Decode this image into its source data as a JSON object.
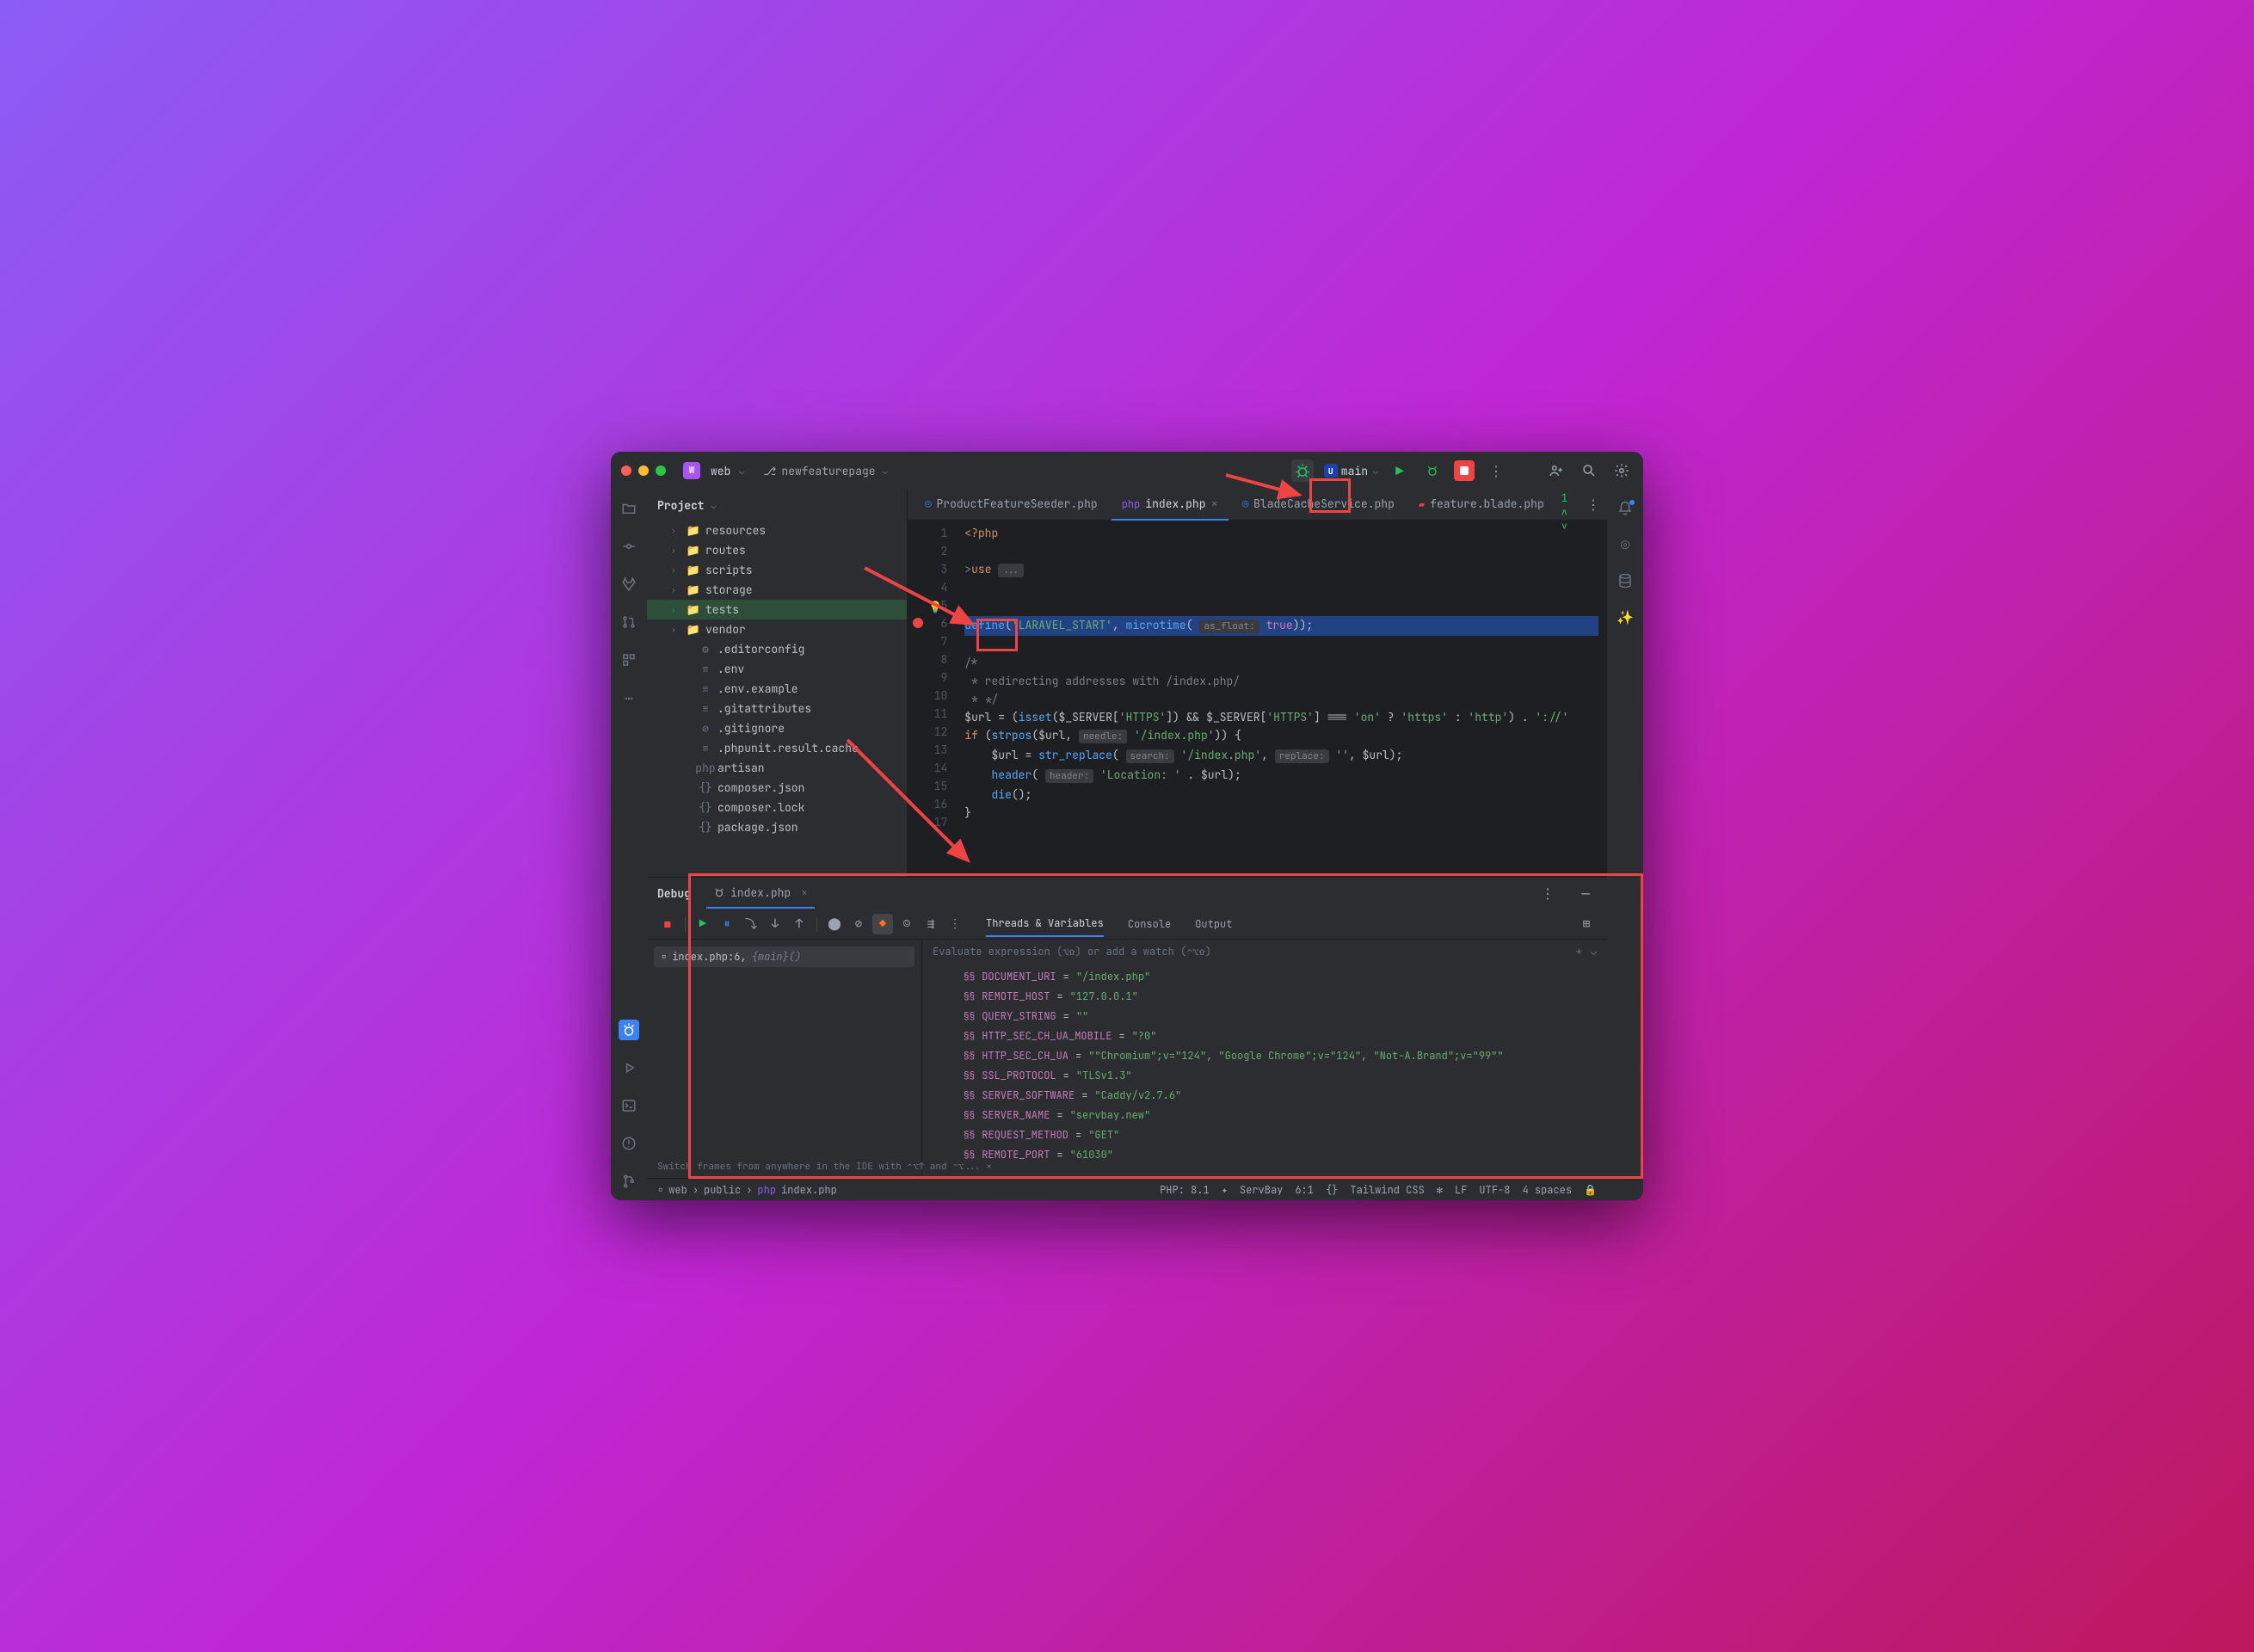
{
  "titlebar": {
    "project": "web",
    "branch": "newfeaturepage",
    "main_label": "main"
  },
  "project_panel": {
    "title": "Project",
    "items": [
      {
        "name": "resources",
        "type": "folder",
        "indent": 28,
        "arrow": true
      },
      {
        "name": "routes",
        "type": "folder",
        "indent": 28,
        "arrow": true
      },
      {
        "name": "scripts",
        "type": "folder",
        "indent": 28,
        "arrow": true
      },
      {
        "name": "storage",
        "type": "folder",
        "indent": 28,
        "arrow": true
      },
      {
        "name": "tests",
        "type": "folder",
        "indent": 28,
        "arrow": true,
        "selected": true
      },
      {
        "name": "vendor",
        "type": "folder-y",
        "indent": 28,
        "arrow": true
      },
      {
        "name": ".editorconfig",
        "type": "gear",
        "indent": 42
      },
      {
        "name": ".env",
        "type": "file",
        "indent": 42
      },
      {
        "name": ".env.example",
        "type": "file",
        "indent": 42
      },
      {
        "name": ".gitattributes",
        "type": "file",
        "indent": 42
      },
      {
        "name": ".gitignore",
        "type": "gitignore",
        "indent": 42
      },
      {
        "name": ".phpunit.result.cache",
        "type": "file",
        "indent": 42
      },
      {
        "name": "artisan",
        "type": "php",
        "indent": 42
      },
      {
        "name": "composer.json",
        "type": "json",
        "indent": 42
      },
      {
        "name": "composer.lock",
        "type": "json",
        "indent": 42
      },
      {
        "name": "package.json",
        "type": "json",
        "indent": 42
      }
    ]
  },
  "tabs": [
    {
      "label": "ProductFeatureSeeder.php",
      "icon": "ring",
      "active": false
    },
    {
      "label": "index.php",
      "icon": "php",
      "active": true,
      "closable": true
    },
    {
      "label": "BladeCacheService.php",
      "icon": "ring",
      "active": false
    },
    {
      "label": "feature.blade.php",
      "icon": "blade",
      "active": false
    }
  ],
  "editor": {
    "lines": [
      "1",
      "2",
      "3",
      "4",
      "5",
      "6",
      "7",
      "8",
      "9",
      "10",
      "11",
      "12",
      "13",
      "14",
      "15",
      "16",
      "17"
    ]
  },
  "debug": {
    "title": "Debug",
    "session": "index.php",
    "frame_file": "index.php:6,",
    "frame_fn": "{main}()",
    "var_tabs": [
      "Threads & Variables",
      "Console",
      "Output"
    ],
    "eval_placeholder": "Evaluate expression (⌥⇧) or add a watch (⌃⌥⇧)",
    "variables": [
      {
        "name": "DOCUMENT_URI",
        "value": "\"/index.php\""
      },
      {
        "name": "REMOTE_HOST",
        "value": "\"127.0.0.1\""
      },
      {
        "name": "QUERY_STRING",
        "value": "\"\""
      },
      {
        "name": "HTTP_SEC_CH_UA_MOBILE",
        "value": "\"?0\""
      },
      {
        "name": "HTTP_SEC_CH_UA",
        "value": "\"\"Chromium\";v=\"124\", \"Google Chrome\";v=\"124\", \"Not-A.Brand\";v=\"99\"\""
      },
      {
        "name": "SSL_PROTOCOL",
        "value": "\"TLSv1.3\""
      },
      {
        "name": "SERVER_SOFTWARE",
        "value": "\"Caddy/v2.7.6\""
      },
      {
        "name": "SERVER_NAME",
        "value": "\"servbay.new\""
      },
      {
        "name": "REQUEST_METHOD",
        "value": "\"GET\""
      },
      {
        "name": "REMOTE_PORT",
        "value": "\"61030\""
      }
    ],
    "tip": "Switch frames from anywhere in the IDE with ⌃⌥↑ and ⌃⌥..."
  },
  "statusbar": {
    "crumbs": [
      "web",
      "public",
      "index.php"
    ],
    "php": "PHP: 8.1",
    "serv": "ServBay",
    "pos": "6:1",
    "tw": "Tailwind CSS",
    "lf": "LF",
    "enc": "UTF-8",
    "indent": "4 spaces"
  }
}
